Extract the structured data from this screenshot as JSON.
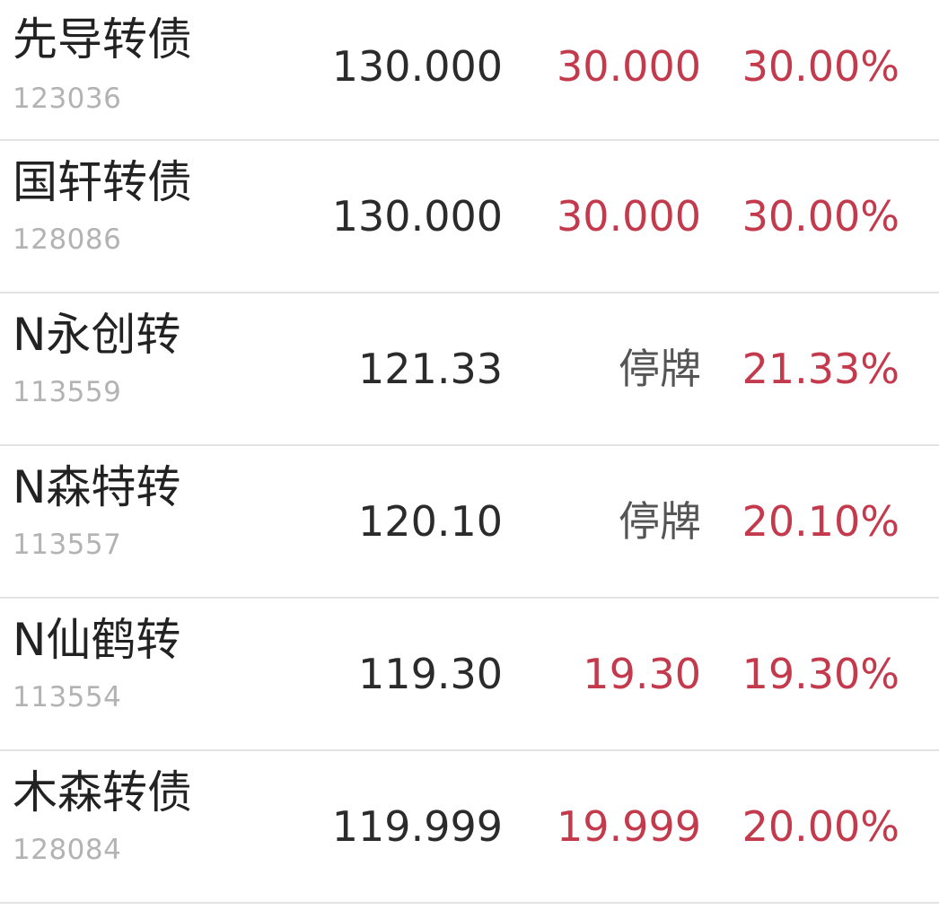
{
  "colors": {
    "up": "#c43a4d",
    "neutral": "#2b2b2b",
    "halted": "#555555",
    "code": "#b3b3b3",
    "divider": "#e3e3e3"
  },
  "rows": [
    {
      "name": "先导转债",
      "code": "123036",
      "price": "130.000",
      "change": "30.000",
      "pct": "30.00%",
      "change_status": "up"
    },
    {
      "name": "国轩转债",
      "code": "128086",
      "price": "130.000",
      "change": "30.000",
      "pct": "30.00%",
      "change_status": "up"
    },
    {
      "name": "N永创转",
      "code": "113559",
      "price": "121.33",
      "change": "停牌",
      "pct": "21.33%",
      "change_status": "halted"
    },
    {
      "name": "N森特转",
      "code": "113557",
      "price": "120.10",
      "change": "停牌",
      "pct": "20.10%",
      "change_status": "halted"
    },
    {
      "name": "N仙鹤转",
      "code": "113554",
      "price": "119.30",
      "change": "19.30",
      "pct": "19.30%",
      "change_status": "up"
    },
    {
      "name": "木森转债",
      "code": "128084",
      "price": "119.999",
      "change": "19.999",
      "pct": "20.00%",
      "change_status": "up"
    }
  ]
}
